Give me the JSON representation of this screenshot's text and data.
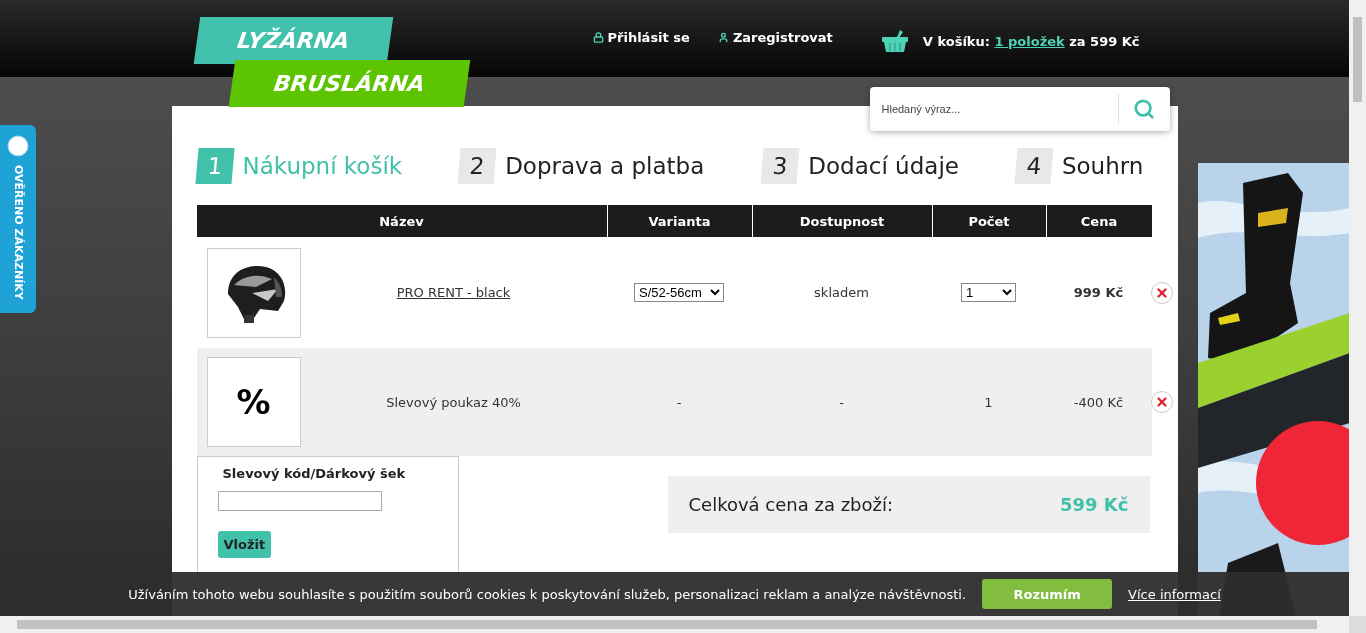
{
  "header": {
    "logo": {
      "line_1": "LYŽÁRNA",
      "line_2": "BRUSLÁRNA"
    },
    "links": [
      {
        "kind": "login",
        "label": "Přihlásit se"
      },
      {
        "kind": "register",
        "label": "Zaregistrovat"
      }
    ],
    "cart": {
      "prefix": "V košíku:",
      "items_link": "1 položek",
      "suffix": "za 599 Kč"
    },
    "search": {
      "placeholder": "Hledaný výraz..."
    }
  },
  "side_tab": {
    "label": "OVĚŘENO ZÁKAZNÍKY"
  },
  "steps": [
    {
      "number": "1",
      "label": "Nákupní košík",
      "selected": true
    },
    {
      "number": "2",
      "label": "Doprava a platba",
      "selected": false
    },
    {
      "number": "3",
      "label": "Dodací údaje",
      "selected": false
    },
    {
      "number": "4",
      "label": "Souhrn",
      "selected": false
    }
  ],
  "table": {
    "columns": [
      "Název",
      "Varianta",
      "Dostupnost",
      "Počet",
      "Cena"
    ],
    "rows": [
      {
        "kind": "product",
        "name": "PRO RENT - black",
        "variant": "S/52-56cm",
        "availability": "skladem",
        "quantity": "1",
        "price": "999 Kč"
      },
      {
        "kind": "discount",
        "symbol": "%",
        "name": "Slevový poukaz 40%",
        "variant": "-",
        "availability": "-",
        "quantity": "1",
        "price": "-400 Kč"
      }
    ]
  },
  "coupon": {
    "title": "Slevový kód/Dárkový šek",
    "button": "Vložit"
  },
  "total": {
    "label": "Celková cena za zboží:",
    "value": "599 Kč"
  },
  "cookie_bar": {
    "text": "Užíváním tohoto webu souhlasíte s použitím souborů cookies k poskytování služeb, personalizaci reklam a analýze návštěvnosti.",
    "accept": "Rozumím",
    "more": "Více informací"
  }
}
